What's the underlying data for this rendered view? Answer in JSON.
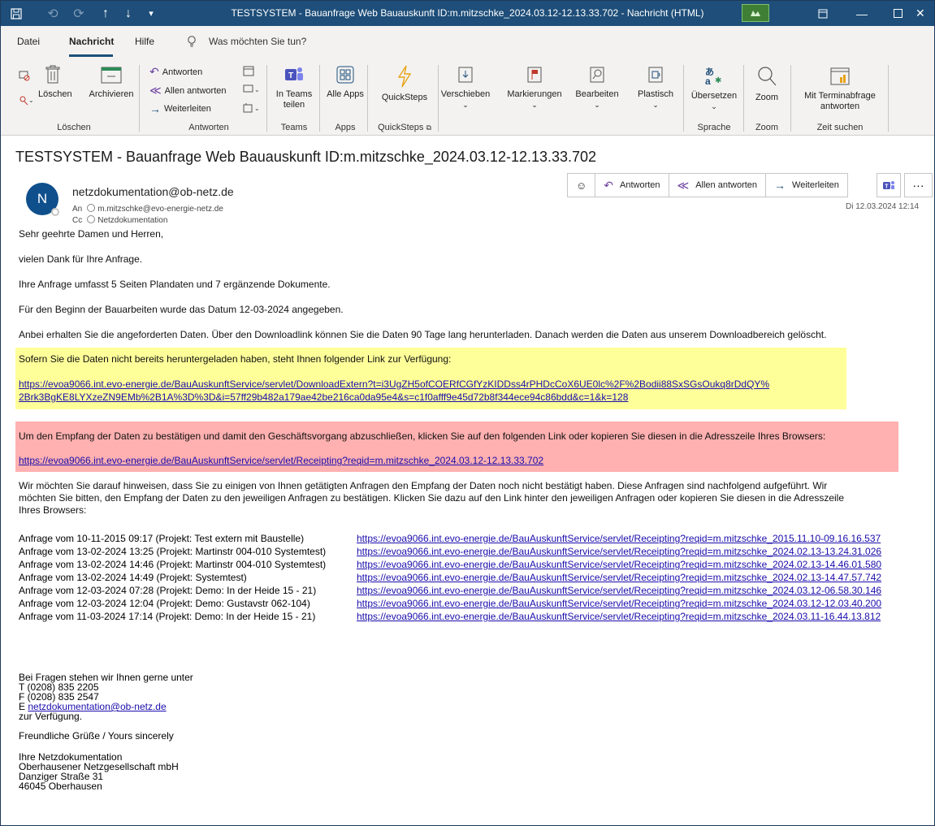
{
  "titlebar": {
    "title": "TESTSYSTEM - Bauanfrage Web Bauauskunft ID:m.mitzschke_2024.03.12-12.13.33.702  -  Nachricht (HTML)"
  },
  "menu": {
    "tabs": [
      "Datei",
      "Nachricht",
      "Hilfe"
    ],
    "search_placeholder": "Was möchten Sie tun?"
  },
  "ribbon": {
    "delete_label": "Löschen",
    "archive_label": "Archivieren",
    "reply_label": "Antworten",
    "reply_all_label": "Allen antworten",
    "forward_label": "Weiterleiten",
    "teams_share_label": "In Teams teilen",
    "all_apps_label": "Alle Apps",
    "quicksteps_label": "QuickSteps",
    "move_label": "Verschieben",
    "flag_label": "Markierungen",
    "edit_label": "Bearbeiten",
    "immersive_label": "Plastisch",
    "translate_label": "Übersetzen",
    "zoom_label": "Zoom",
    "meeting_poll_label": "Mit Terminabfrage antworten",
    "groups": [
      "Löschen",
      "Antworten",
      "Teams",
      "Apps",
      "QuickSteps",
      "Sprache",
      "Zoom",
      "Zeit suchen"
    ]
  },
  "email": {
    "subject": "TESTSYSTEM - Bauanfrage Web Bauauskunft ID:m.mitzschke_2024.03.12-12.13.33.702",
    "avatar_initial": "N",
    "sender": "netzdokumentation@ob-netz.de",
    "to_label": "An",
    "to": "m.mitzschke@evo-energie-netz.de",
    "cc_label": "Cc",
    "cc": "Netzdokumentation",
    "date": "Di 12.03.2024 12:14",
    "actions": {
      "reply": "Antworten",
      "reply_all": "Allen antworten",
      "forward": "Weiterleiten"
    }
  },
  "body": {
    "greeting": "Sehr geehrte Damen und Herren,",
    "thanks": "vielen Dank für Ihre Anfrage.",
    "scope": "Ihre Anfrage umfasst 5 Seiten Plandaten und 7 ergänzende Dokumente.",
    "start_date": "Für den Beginn der Bauarbeiten wurde das Datum 12-03-2024 angegeben.",
    "download_info": "Anbei erhalten Sie die angeforderten Daten. Über den Downloadlink können Sie die Daten 90 Tage lang herunterladen. Danach werden die Daten aus unserem Downloadbereich gelöscht.",
    "download_hint": "Sofern Sie die Daten nicht bereits heruntergeladen haben, steht Ihnen folgender Link zur Verfügung:",
    "download_link_1": "https://evoa9066.int.evo-energie.de/BauAuskunftService/servlet/DownloadExtern?t=i3UgZH5ofCOERfCGfYzKIDDss4rPHDcCoX6UE0lc%2F%2Bodii88SxSGsOukq8rDdQY%",
    "download_link_2": "2Brk3BgKE8LYXzeZN9EMb%2B1A%3D%3D&i=57ff29b482a179ae42be216ca0da95e4&s=c1f0afff9e45d72b8f344ece94c86bdd&c=1&k=128",
    "confirm_hint": "Um den Empfang der Daten zu bestätigen und damit den Geschäftsvorgang abzuschließen, klicken Sie auf den folgenden Link oder kopieren Sie diesen in die Adresszeile Ihres Browsers:",
    "confirm_link": "https://evoa9066.int.evo-energie.de/BauAuskunftService/servlet/Receipting?reqid=m.mitzschke_2024.03.12-12.13.33.702",
    "pending_1": "Wir möchten Sie darauf hinweisen, dass Sie zu einigen von Ihnen getätigten Anfragen den Empfang der Daten noch nicht bestätigt haben. Diese Anfragen sind nachfolgend aufgeführt. Wir",
    "pending_2": "möchten Sie bitten, den Empfang der Daten zu den jeweiligen Anfragen zu bestätigen. Klicken Sie dazu auf den Link hinter den jeweiligen Anfragen oder kopieren Sie diesen in die Adresszeile",
    "pending_3": "Ihres Browsers:",
    "requests": [
      {
        "label": "Anfrage vom 10-11-2015 09:17 (Projekt: Test extern mit Baustelle)",
        "link": "https://evoa9066.int.evo-energie.de/BauAuskunftService/servlet/Receipting?reqid=m.mitzschke_2015.11.10-09.16.16.537"
      },
      {
        "label": "Anfrage vom 13-02-2024 13:25 (Projekt: Martinstr 004-010 Systemtest)",
        "link": "https://evoa9066.int.evo-energie.de/BauAuskunftService/servlet/Receipting?reqid=m.mitzschke_2024.02.13-13.24.31.026"
      },
      {
        "label": "Anfrage vom 13-02-2024 14:46 (Projekt: Martinstr 004-010 Systemtest)",
        "link": "https://evoa9066.int.evo-energie.de/BauAuskunftService/servlet/Receipting?reqid=m.mitzschke_2024.02.13-14.46.01.580"
      },
      {
        "label": "Anfrage vom 13-02-2024 14:49 (Projekt: Systemtest)",
        "link": "https://evoa9066.int.evo-energie.de/BauAuskunftService/servlet/Receipting?reqid=m.mitzschke_2024.02.13-14.47.57.742"
      },
      {
        "label": "Anfrage vom 12-03-2024 07:28 (Projekt: Demo: In der Heide 15 - 21)",
        "link": "https://evoa9066.int.evo-energie.de/BauAuskunftService/servlet/Receipting?reqid=m.mitzschke_2024.03.12-06.58.30.146"
      },
      {
        "label": "Anfrage vom 12-03-2024 12:04 (Projekt: Demo: Gustavstr 062-104)",
        "link": "https://evoa9066.int.evo-energie.de/BauAuskunftService/servlet/Receipting?reqid=m.mitzschke_2024.03.12-12.03.40.200"
      },
      {
        "label": "Anfrage vom 11-03-2024 17:14 (Projekt: Demo: In der Heide 15 - 21)",
        "link": "https://evoa9066.int.evo-energie.de/BauAuskunftService/servlet/Receipting?reqid=m.mitzschke_2024.03.11-16.44.13.812"
      }
    ],
    "questions": "Bei Fragen stehen wir Ihnen gerne unter",
    "phone": "T (0208) 835 2205",
    "fax": "F (0208) 835 2547",
    "email_prefix": "E",
    "email": "netzdokumentation@ob-netz.de",
    "available": "zur Verfügung.",
    "regards": "Freundliche Grüße / Yours sincerely",
    "sig_1": "Ihre Netzdokumentation",
    "sig_2": "Oberhausener Netzgesellschaft mbH",
    "sig_3": "Danziger Straße 31",
    "sig_4": "46045 Oberhausen"
  },
  "colors": {
    "titlebar": "#1e4e79",
    "link": "#1a0dab",
    "highlight_yellow": "#ffff99",
    "highlight_red": "#ffb0b0",
    "avatar": "#0f4f8c"
  }
}
